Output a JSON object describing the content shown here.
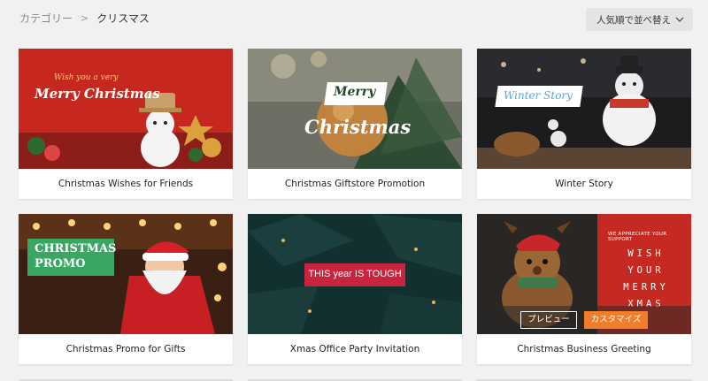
{
  "breadcrumb": {
    "parent": "カテゴリー",
    "separator": ">",
    "current": "クリスマス"
  },
  "sort": {
    "label": "人気順で並べ替え",
    "icon": "chevron-down-icon"
  },
  "cards": [
    {
      "title": "Christmas Wishes for Friends",
      "overlay_small": "Wish you a very",
      "overlay_big": "Merry Christmas"
    },
    {
      "title": "Christmas Giftstore Promotion",
      "overlay_small": "Merry",
      "overlay_big": "Christmas"
    },
    {
      "title": "Winter Story",
      "overlay": "Winter Story"
    },
    {
      "title": "Christmas Promo for Gifts",
      "overlay_line1": "CHRISTMAS",
      "overlay_line2": "PROMO"
    },
    {
      "title": "Xmas Office Party Invitation",
      "overlay": "THIS year IS TOUGH"
    },
    {
      "title": "Christmas Business Greeting",
      "overlay_small": "WE APPRECIATE YOUR SUPPORT",
      "overlay_letters": [
        "WISH",
        "YOUR",
        "MERRY",
        "XMAS"
      ],
      "preview_label": "プレビュー",
      "customize_label": "カスタマイズ"
    }
  ],
  "colors": {
    "accent": "#ef7d2b",
    "promo_green": "#3aa663",
    "tough_red": "#c8243f",
    "card_bg": "#ffffff",
    "page_bg": "#f1f1f1"
  }
}
